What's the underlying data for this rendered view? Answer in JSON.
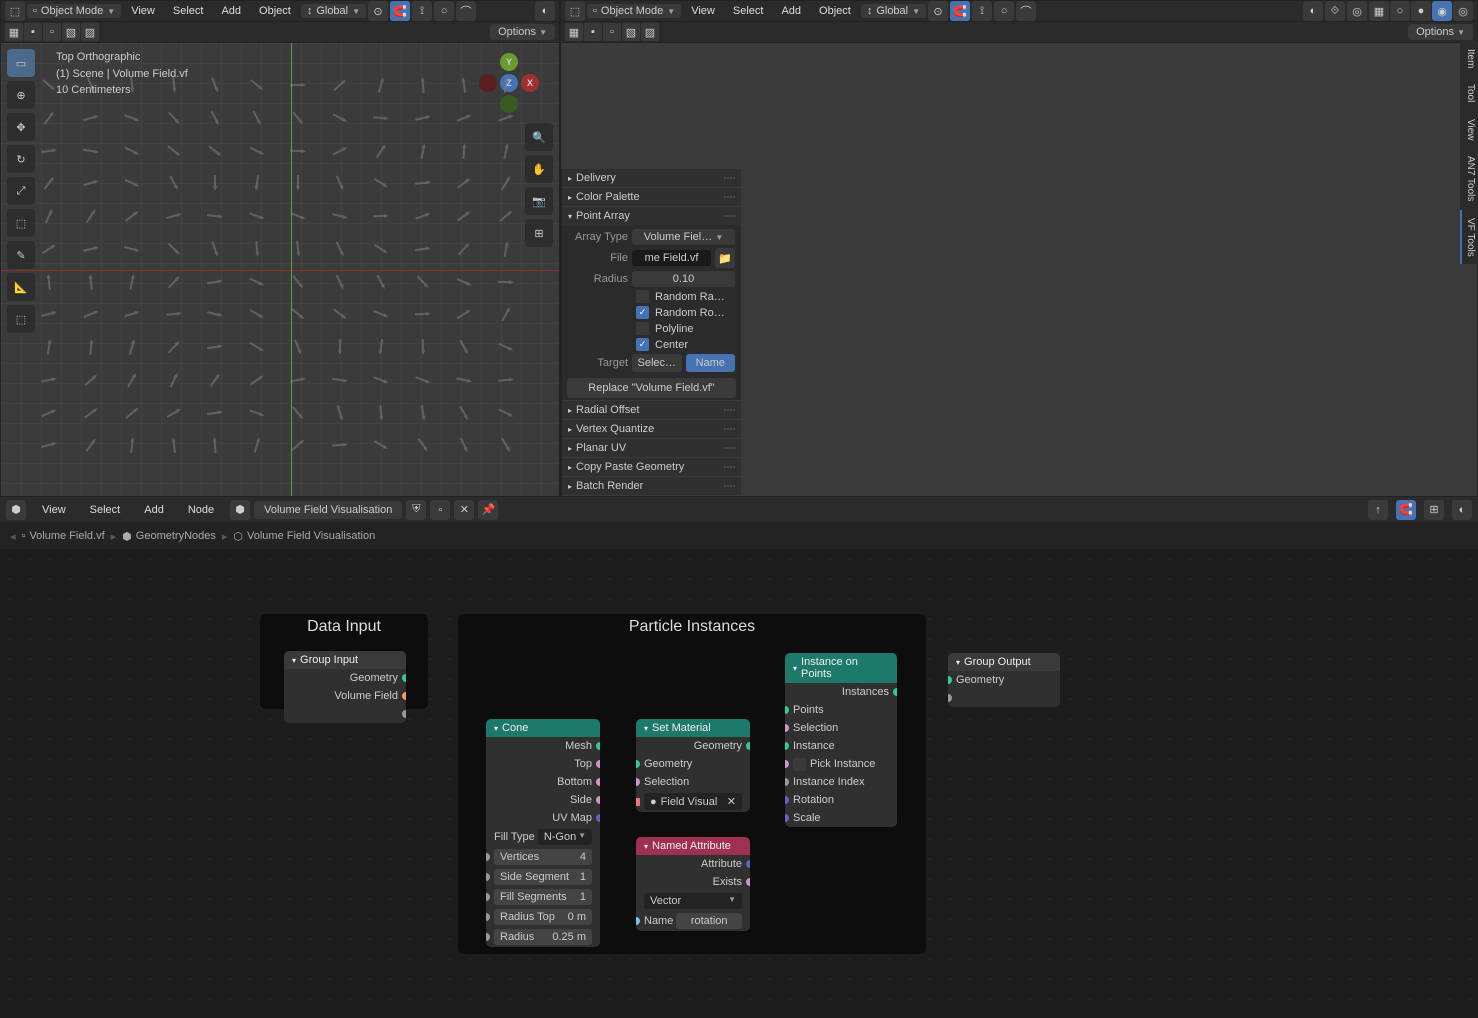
{
  "viewport_left": {
    "mode": "Object Mode",
    "menus": [
      "View",
      "Select",
      "Add",
      "Object"
    ],
    "orientation": "Global",
    "info": {
      "view": "Top Orthographic",
      "scene": "(1) Scene | Volume Field.vf",
      "scale": "10 Centimeters"
    },
    "options": "Options"
  },
  "viewport_right": {
    "mode": "Object Mode",
    "menus": [
      "View",
      "Select",
      "Add",
      "Object"
    ],
    "orientation": "Global",
    "options": "Options"
  },
  "side_panel": {
    "tabs": [
      "Item",
      "Tool",
      "View",
      "AN7 Tools",
      "VF Tools"
    ],
    "sections": {
      "delivery": "Delivery",
      "color_palette": "Color Palette",
      "point_array": {
        "title": "Point Array",
        "array_type_label": "Array Type",
        "array_type_value": "Volume Fiel…",
        "file_label": "File",
        "file_value": "me Field.vf",
        "radius_label": "Radius",
        "radius_value": "0.10",
        "random_ra": "Random Ra…",
        "random_ro": "Random Ro…",
        "polyline": "Polyline",
        "center": "Center",
        "target_label": "Target",
        "target_select": "Selec…",
        "target_name": "Name",
        "replace": "Replace \"Volume Field.vf\""
      },
      "radial_offset": "Radial Offset",
      "vertex_quantize": "Vertex Quantize",
      "planar_uv": "Planar UV",
      "copy_paste": "Copy Paste Geometry",
      "batch_render": "Batch Render"
    }
  },
  "node_editor": {
    "menus": [
      "View",
      "Select",
      "Add",
      "Node"
    ],
    "tree_name": "Volume Field Visualisation",
    "breadcrumb": [
      {
        "icon": "mesh",
        "label": "Volume Field.vf"
      },
      {
        "icon": "modifier",
        "label": "GeometryNodes"
      },
      {
        "icon": "nodetree",
        "label": "Volume Field Visualisation"
      }
    ],
    "frames": {
      "data_input": "Data Input",
      "particle_instances": "Particle Instances"
    },
    "nodes": {
      "group_input": {
        "title": "Group Input",
        "outputs": [
          "Geometry",
          "Volume Field"
        ]
      },
      "cone": {
        "title": "Cone",
        "outputs": [
          "Mesh",
          "Top",
          "Bottom",
          "Side",
          "UV Map"
        ],
        "fill_label": "Fill Type",
        "fill_value": "N-Gon",
        "props": [
          {
            "name": "Vertices",
            "value": "4"
          },
          {
            "name": "Side Segment",
            "value": "1"
          },
          {
            "name": "Fill Segments",
            "value": "1"
          },
          {
            "name": "Radius Top",
            "value": "0 m"
          },
          {
            "name": "Radius",
            "value": "0.25 m"
          }
        ]
      },
      "set_material": {
        "title": "Set Material",
        "outputs": [
          "Geometry"
        ],
        "inputs": [
          "Geometry",
          "Selection"
        ],
        "material": "Field Visual"
      },
      "named_attribute": {
        "title": "Named Attribute",
        "outputs": [
          "Attribute",
          "Exists"
        ],
        "type": "Vector",
        "name_label": "Name",
        "name_value": "rotation"
      },
      "instance_on_points": {
        "title": "Instance on Points",
        "outputs": [
          "Instances"
        ],
        "inputs": [
          "Points",
          "Selection",
          "Instance",
          "Pick Instance",
          "Instance Index",
          "Rotation",
          "Scale"
        ]
      },
      "group_output": {
        "title": "Group Output",
        "inputs": [
          "Geometry"
        ]
      }
    }
  }
}
